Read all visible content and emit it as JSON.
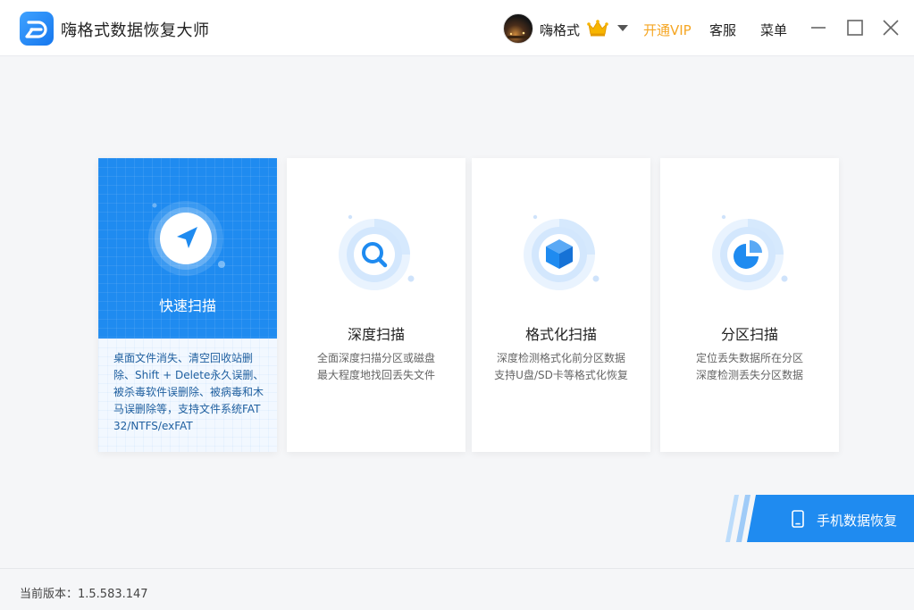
{
  "window": {
    "title": "嗨格式数据恢复大师",
    "username": "嗨格式",
    "vip_label": "开通VIP",
    "service_label": "客服",
    "menu_label": "菜单"
  },
  "colors": {
    "brand": "#1f8bf0",
    "vip": "#f5a623",
    "text": "#222222"
  },
  "icons": {
    "logo": "app-logo-icon",
    "crown": "crown-icon",
    "minimize": "minimize-icon",
    "maximize": "maximize-icon",
    "close": "close-icon",
    "quick": "navigation-arrow-icon",
    "deep": "magnifier-icon",
    "format": "cube-icon",
    "partition": "pie-chart-icon",
    "mobile": "phone-icon"
  },
  "scan_modes": [
    {
      "title": "快速扫描",
      "description": "桌面文件消失、清空回收站删除、Shift + Delete永久误删、被杀毒软件误删除、被病毒和木马误删除等，支持文件系统FAT32/NTFS/exFAT",
      "selected": true
    },
    {
      "title": "深度扫描",
      "lines": [
        "全面深度扫描分区或磁盘",
        "最大程度地找回丢失文件"
      ]
    },
    {
      "title": "格式化扫描",
      "lines": [
        "深度检测格式化前分区数据",
        "支持U盘/SD卡等格式化恢复"
      ]
    },
    {
      "title": "分区扫描",
      "lines": [
        "定位丢失数据所在分区",
        "深度检测丢失分区数据"
      ]
    }
  ],
  "mobile_recovery": {
    "label": "手机数据恢复"
  },
  "footer": {
    "version": "当前版本：1.5.583.147"
  }
}
